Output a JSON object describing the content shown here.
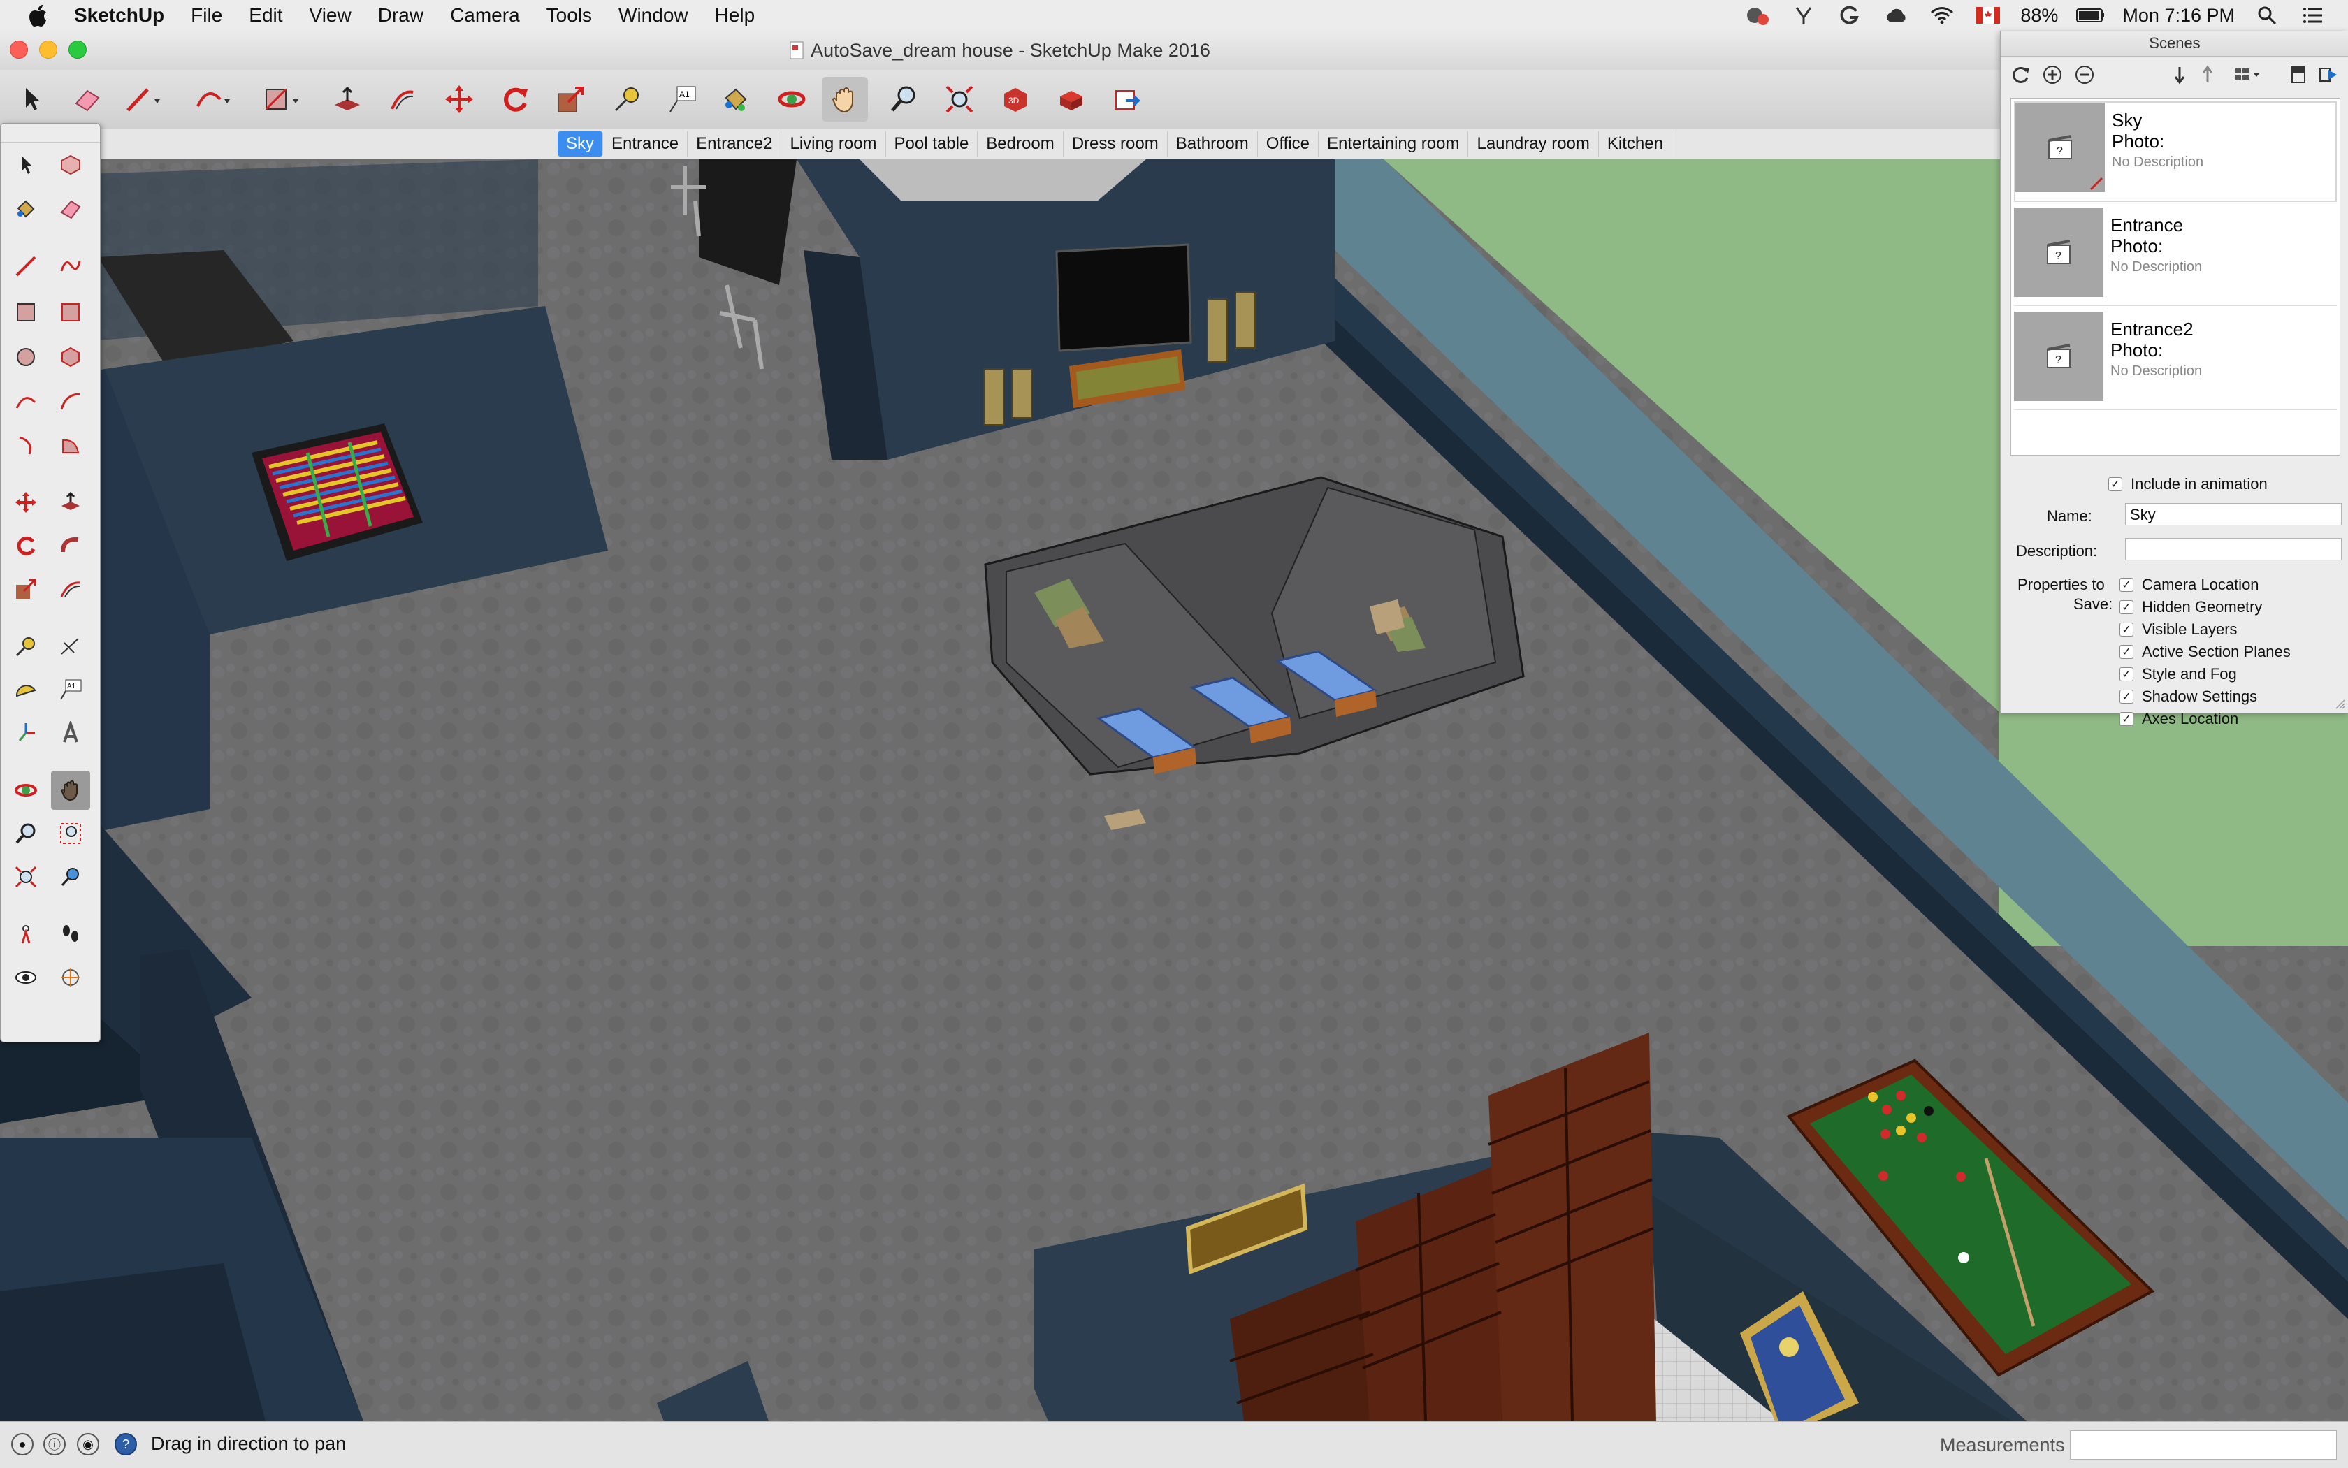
{
  "menubar": {
    "app_name": "SketchUp",
    "items": [
      "File",
      "Edit",
      "View",
      "Draw",
      "Camera",
      "Tools",
      "Window",
      "Help"
    ],
    "battery": "88%",
    "clock": "Mon 7:16 PM"
  },
  "window": {
    "title": "AutoSave_dream house - SketchUp Make 2016"
  },
  "toolbar": {
    "tools": [
      "select-tool",
      "eraser-tool",
      "line-tool",
      "arc-tool",
      "rectangle-tool",
      "push-pull-tool",
      "offset-tool",
      "move-tool",
      "rotate-tool",
      "scale-tool",
      "tape-measure-tool",
      "text-tool",
      "paint-bucket-tool",
      "orbit-tool",
      "pan-tool",
      "zoom-tool",
      "zoom-extents-tool",
      "3d-warehouse-tool",
      "extension-warehouse-tool",
      "share-model-tool"
    ]
  },
  "scenes_bar": {
    "tabs": [
      "Sky",
      "Entrance",
      "Entrance2",
      "Living room",
      "Pool table",
      "Bedroom",
      "Dress room",
      "Bathroom",
      "Office",
      "Entertaining room",
      "Laundray room",
      "Kitchen"
    ],
    "active": "Sky"
  },
  "scenes_panel": {
    "title": "Scenes",
    "scenes": [
      {
        "name": "Sky",
        "photo": "Photo:",
        "description": "No Description"
      },
      {
        "name": "Entrance",
        "photo": "Photo:",
        "description": "No Description"
      },
      {
        "name": "Entrance2",
        "photo": "Photo:",
        "description": "No Description"
      }
    ],
    "include_in_animation": "Include in animation",
    "name_label": "Name:",
    "name_value": "Sky",
    "description_label": "Description:",
    "description_value": "",
    "properties_label_1": "Properties to",
    "properties_label_2": "Save:",
    "properties": [
      "Camera Location",
      "Hidden Geometry",
      "Visible Layers",
      "Active Section Planes",
      "Style and Fog",
      "Shadow Settings",
      "Axes Location"
    ]
  },
  "status": {
    "hint": "Drag in direction to pan",
    "measurements_label": "Measurements"
  },
  "colors": {
    "accent": "#3b8ef0",
    "wall": "#2b3d4f",
    "floor": "#6e6e6f",
    "lawn": "#8fb985"
  }
}
